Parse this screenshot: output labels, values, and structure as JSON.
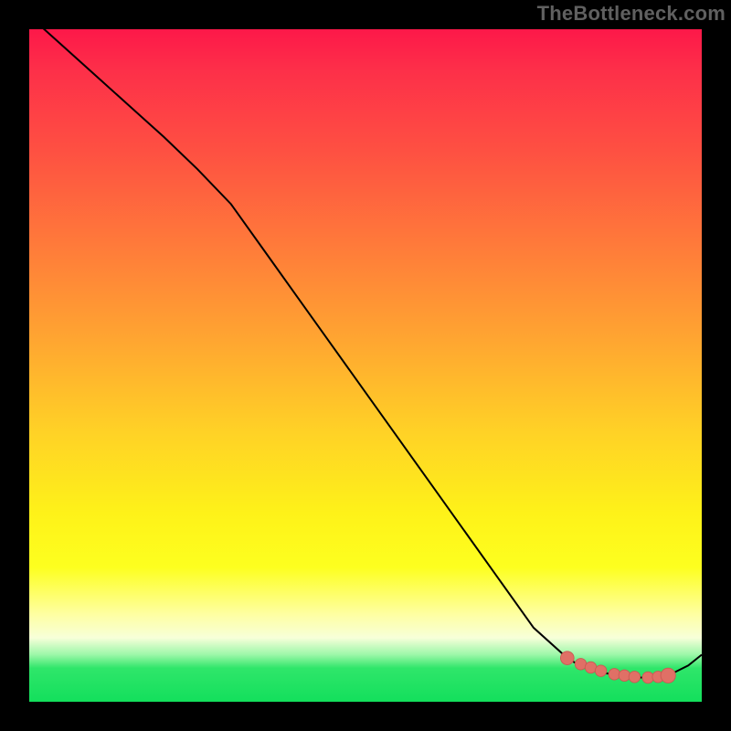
{
  "watermark": "TheBottleneck.com",
  "colors": {
    "background": "#000000",
    "curve": "#000000",
    "point_fill": "#e07066",
    "point_stroke": "#c95a52",
    "watermark": "#606060"
  },
  "chart_data": {
    "type": "line",
    "title": "",
    "xlabel": "",
    "ylabel": "",
    "xlim": [
      0,
      100
    ],
    "ylim": [
      0,
      100
    ],
    "series": [
      {
        "name": "bottleneck-curve",
        "x": [
          0,
          5,
          10,
          15,
          20,
          25,
          30,
          35,
          40,
          45,
          50,
          55,
          60,
          65,
          70,
          75,
          80,
          82,
          85,
          88,
          90,
          92,
          94,
          96,
          98,
          100
        ],
        "y": [
          102,
          97.5,
          93,
          88.5,
          84,
          79.2,
          74,
          67,
          60,
          53,
          46,
          39,
          32,
          25,
          18,
          11,
          6.5,
          5.3,
          4.4,
          3.8,
          3.6,
          3.6,
          3.8,
          4.4,
          5.4,
          7
        ]
      }
    ],
    "points": {
      "name": "highlighted-range",
      "x": [
        80,
        82,
        83.5,
        85,
        87,
        88.5,
        90,
        92,
        93.5,
        95
      ],
      "y": [
        6.5,
        5.6,
        5.1,
        4.6,
        4.1,
        3.9,
        3.7,
        3.6,
        3.7,
        3.9
      ]
    }
  }
}
